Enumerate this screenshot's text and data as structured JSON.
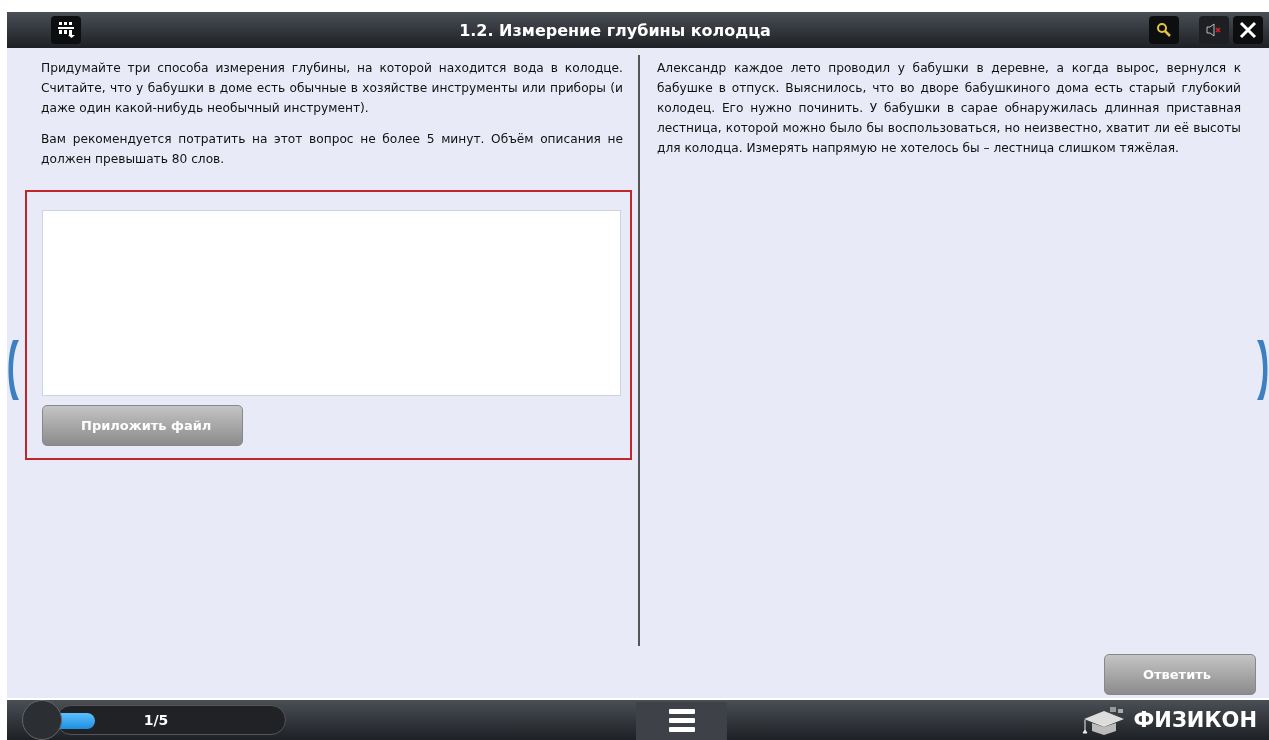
{
  "window": {
    "title": "1.2. Измерение глубины колодца"
  },
  "task": {
    "paragraphs": [
      "Придумайте три способа измерения глубины, на которой находится вода в колодце. Считайте, что у бабушки в доме есть обычные в хозяйстве инструменты или приборы (и даже один какой-нибудь необычный инструмент).",
      "Вам рекомендуется потратить на этот вопрос не более 5 минут. Объём описания не должен превышать 80 слов."
    ],
    "attach_button": "Приложить файл"
  },
  "story": {
    "text": "Александр каждое лето проводил у бабушки в деревне, а когда вырос, вернулся к бабушке в отпуск. Выяснилось, что во дворе бабушкиного дома есть старый глубокий колодец. Его нужно починить. У бабушки в сарае обнаружилась длинная приставная лестница, которой можно было бы воспользоваться, но неизвестно, хватит ли её высоты для колодца. Измерять напрямую не хотелось бы – лестница слишком тяжёлая."
  },
  "submit_button": "Ответить",
  "progress": {
    "label": "1/5",
    "level": 0.2
  },
  "logo": "ФИЗИКОН"
}
